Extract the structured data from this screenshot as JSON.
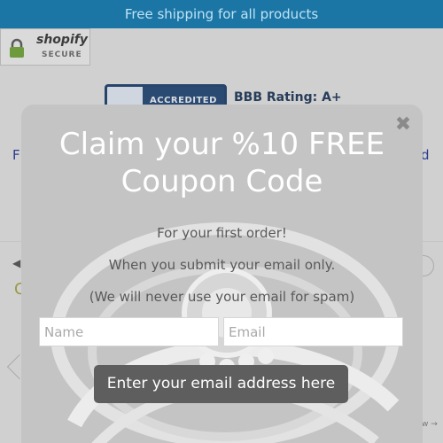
{
  "banner": {
    "text": "Free shipping for all products"
  },
  "shopify_badge": {
    "brand": "shopify",
    "label": "SECURE"
  },
  "bbb": {
    "badge_text": "ACCREDITED",
    "rating": "BBB Rating: A+"
  },
  "background": {
    "left_fragment": "F",
    "right_fragment": "d",
    "c_fragment": "C",
    "w_fragment": "w →"
  },
  "modal": {
    "close_label": "✖",
    "headline_line1": "Claim your %10 FREE",
    "headline_line2": "Coupon Code",
    "line1": "For your first order!",
    "line2": "When you submit your email only.",
    "line3": "(We will never use your email for spam)",
    "name_placeholder": "Name",
    "email_placeholder": "Email",
    "submit_label": "Enter your email address here"
  },
  "colors": {
    "banner": "#1b76a6",
    "banner_text": "#bfe3f4",
    "button": "#5e5e5e",
    "bbb": "#2a4a72"
  }
}
